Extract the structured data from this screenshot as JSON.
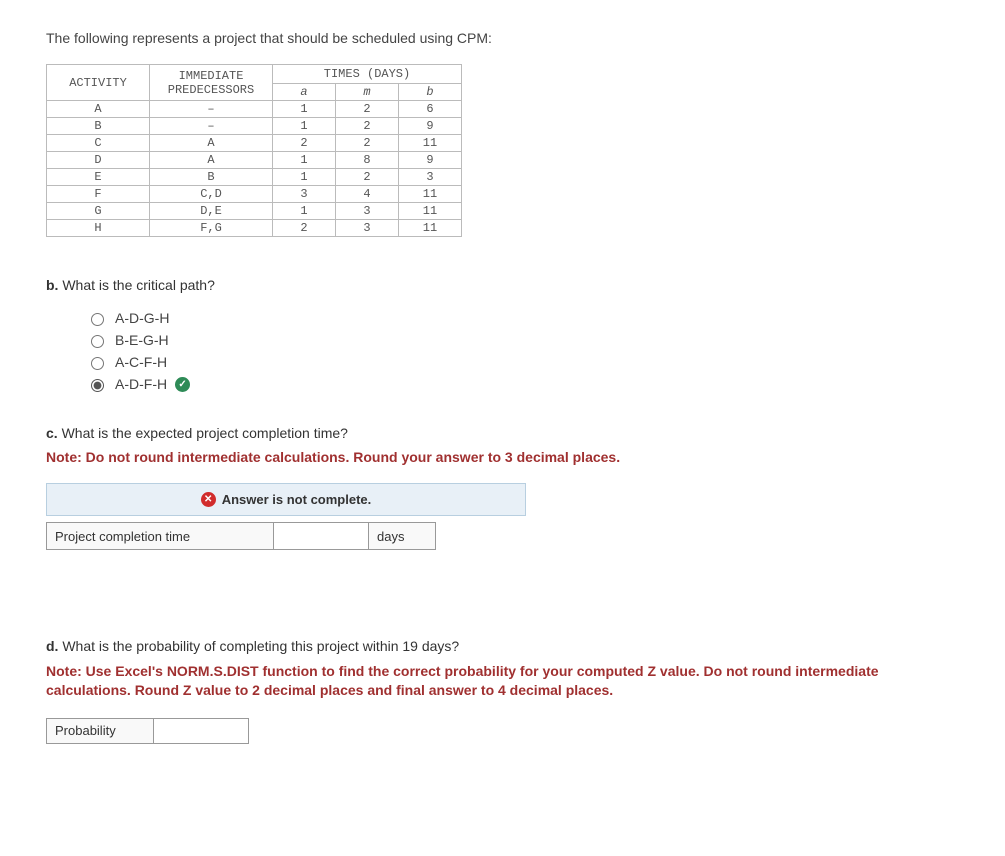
{
  "intro": "The following represents a project that should be scheduled using CPM:",
  "table": {
    "header1": {
      "activity": "ACTIVITY",
      "pred": "IMMEDIATE PREDECESSORS",
      "times": "TIMES (DAYS)"
    },
    "header2": {
      "a": "a",
      "m": "m",
      "b": "b"
    },
    "rows": [
      {
        "activity": "A",
        "pred": "–",
        "a": "1",
        "m": "2",
        "b": "6"
      },
      {
        "activity": "B",
        "pred": "–",
        "a": "1",
        "m": "2",
        "b": "9"
      },
      {
        "activity": "C",
        "pred": "A",
        "a": "2",
        "m": "2",
        "b": "11"
      },
      {
        "activity": "D",
        "pred": "A",
        "a": "1",
        "m": "8",
        "b": "9"
      },
      {
        "activity": "E",
        "pred": "B",
        "a": "1",
        "m": "2",
        "b": "3"
      },
      {
        "activity": "F",
        "pred": "C,D",
        "a": "3",
        "m": "4",
        "b": "11"
      },
      {
        "activity": "G",
        "pred": "D,E",
        "a": "1",
        "m": "3",
        "b": "11"
      },
      {
        "activity": "H",
        "pred": "F,G",
        "a": "2",
        "m": "3",
        "b": "11"
      }
    ]
  },
  "b": {
    "label_prefix": "b.",
    "label_text": " What is the critical path?",
    "options": [
      {
        "text": "A-D-G-H",
        "selected": false,
        "correct": false
      },
      {
        "text": "B-E-G-H",
        "selected": false,
        "correct": false
      },
      {
        "text": "A-C-F-H",
        "selected": false,
        "correct": false
      },
      {
        "text": "A-D-F-H",
        "selected": true,
        "correct": true
      }
    ]
  },
  "c": {
    "label_prefix": "c.",
    "label_text": " What is the expected project completion time?",
    "note": "Note: Do not round intermediate calculations. Round your answer to 3 decimal places.",
    "feedback": "Answer is not complete.",
    "row_label": "Project completion time",
    "unit": "days",
    "value": ""
  },
  "d": {
    "label_prefix": "d.",
    "label_text": " What is the probability of completing this project within 19 days?",
    "note": "Note: Use Excel's NORM.S.DIST function to find the correct probability for your computed Z value. Do not round intermediate calculations. Round Z value to 2 decimal places and final answer to 4 decimal places.",
    "row_label": "Probability",
    "value": ""
  }
}
